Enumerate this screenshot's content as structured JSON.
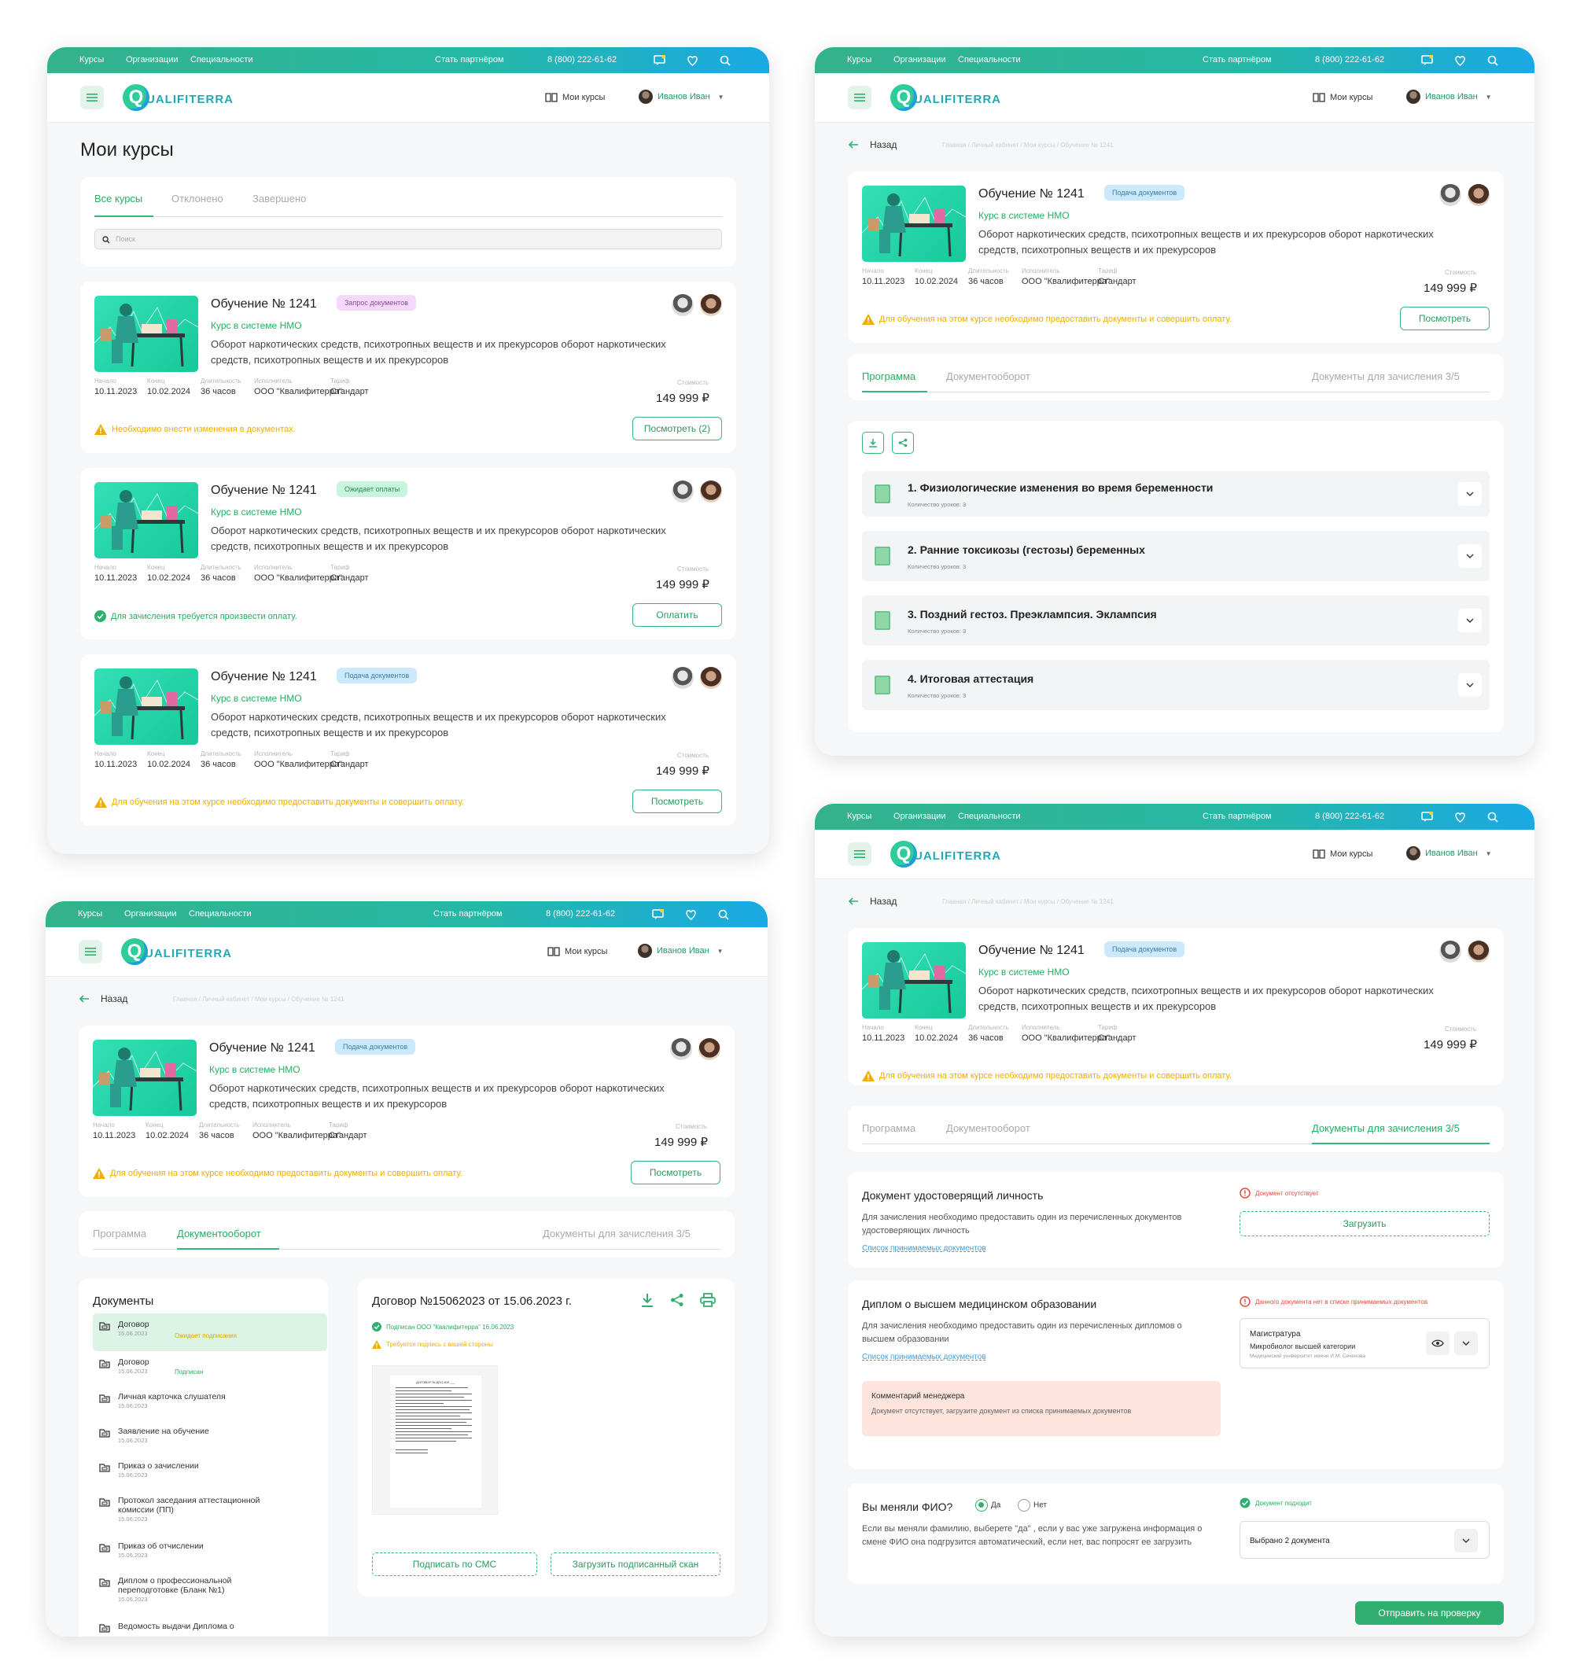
{
  "nav": {
    "courses": "Курсы",
    "organizations": "Организации",
    "specialties": "Специальности",
    "partner": "Стать партнёром",
    "phone": "8 (800) 222-61-62",
    "logo_text": "UALIFITERRA",
    "my_courses": "Мои курсы",
    "user_name": "Иванов Иван"
  },
  "colors": {
    "accent": "#2fb070",
    "gradient_start": "#34b28b",
    "gradient_end": "#1aa9e4",
    "warning": "#f0ad00",
    "error": "#e84a3a"
  },
  "icons": [
    "menu-icon",
    "chat-icon",
    "heart-icon",
    "search-icon",
    "book-icon",
    "chevron-down-icon",
    "warning-icon",
    "check-circle-icon",
    "download-icon",
    "share-icon",
    "print-icon",
    "folder-icon",
    "eye-icon",
    "arrow-left-icon",
    "error-icon"
  ],
  "list_page": {
    "title": "Мои курсы",
    "tabs": [
      "Все курсы",
      "Отклонено",
      "Завершено"
    ],
    "search_placeholder": "Поиск",
    "courses": [
      {
        "title": "Обучение № 1241",
        "badge": "Запрос документов",
        "subtitle": "Курс в системе НМО",
        "description": "Оборот наркотических средств, психотропных веществ  и их прекурсоров оборот наркотических средств, психотропных веществ  и их прекурсоров",
        "start_label": "Начало",
        "start": "10.11.2023",
        "end_label": "Конец",
        "end": "10.02.2024",
        "dur_label": "Длительность",
        "duration": "36 часов",
        "exec_label": "Исполнитель",
        "executor": "ООО \"Квалифитерра\"",
        "tariff_label": "Тариф",
        "tariff": "Стандарт",
        "cost_label": "Стоимость",
        "price": "149 999 ₽",
        "notice": "Необходимо внести изменения в документах.",
        "button": "Посмотреть (2)"
      },
      {
        "title": "Обучение № 1241",
        "badge": "Ожидает оплаты",
        "subtitle": "Курс в системе НМО",
        "description": "Оборот наркотических средств, психотропных веществ  и их прекурсоров оборот наркотических средств, психотропных веществ  и их прекурсоров",
        "start_label": "Начало",
        "start": "10.11.2023",
        "end_label": "Конец",
        "end": "10.02.2024",
        "dur_label": "Длительность",
        "duration": "36 часов",
        "exec_label": "Исполнитель",
        "executor": "ООО \"Квалифитерра\"",
        "tariff_label": "Тариф",
        "tariff": "Стандарт",
        "cost_label": "Стоимость",
        "price": "149 999 ₽",
        "notice": "Для зачисления требуется произвести оплату.",
        "button": "Оплатить"
      },
      {
        "title": "Обучение № 1241",
        "badge": "Подача документов",
        "subtitle": "Курс в системе НМО",
        "description": "Оборот наркотических средств, психотропных веществ  и их прекурсоров оборот наркотических средств, психотропных веществ  и их прекурсоров",
        "start_label": "Начало",
        "start": "10.11.2023",
        "end_label": "Конец",
        "end": "10.02.2024",
        "dur_label": "Длительность",
        "duration": "36 часов",
        "exec_label": "Исполнитель",
        "executor": "ООО \"Квалифитерра\"",
        "tariff_label": "Тариф",
        "tariff": "Стандарт",
        "cost_label": "Стоимость",
        "price": "149 999 ₽",
        "notice": "Для обучения на этом курсе необходимо предоставить документы и совершить оплату.",
        "button": "Посмотреть"
      }
    ]
  },
  "detail": {
    "back": "Назад",
    "breadcrumbs": "Главная / Личный кабинет / Мои курсы / Обучение № 1241",
    "title": "Обучение № 1241",
    "badge": "Подача документов",
    "subtitle": "Курс в системе НМО",
    "description": "Оборот наркотических средств, психотропных веществ  и их прекурсоров оборот наркотических средств, психотропных веществ  и их прекурсоров",
    "start_label": "Начало",
    "start": "10.11.2023",
    "end_label": "Конец",
    "end": "10.02.2024",
    "dur_label": "Длительность",
    "duration": "36 часов",
    "exec_label": "Исполнитель",
    "executor": "ООО \"Квалифитерра\"",
    "tariff_label": "Тариф",
    "tariff": "Стандарт",
    "cost_label": "Стоимость",
    "price": "149 999 ₽",
    "notice": "Для обучения на этом курсе необходимо предоставить документы и совершить оплату.",
    "button": "Посмотреть",
    "tabs": [
      "Программа",
      "Документооборот",
      "Документы для зачисления 3/5"
    ]
  },
  "program": {
    "modules": [
      {
        "title": "1. Физиологические изменения во время беременности",
        "lessons": "Количество уроков: 3"
      },
      {
        "title": "2. Ранние токсикозы (гестозы) беременных",
        "lessons": "Количество уроков: 3"
      },
      {
        "title": "3. Поздний гестоз. Преэклампсия. Эклампсия",
        "lessons": "Количество уроков: 3"
      },
      {
        "title": "4. Итоговая аттестация",
        "lessons": "Количество уроков: 3"
      }
    ]
  },
  "docflow": {
    "list_title": "Документы",
    "documents": [
      {
        "name": "Договор",
        "date": "15.06.2023",
        "status": "Ожидает подписания"
      },
      {
        "name": "Договор",
        "date": "15.06.2023",
        "status": "Подписан"
      },
      {
        "name": "Личная карточка слушателя",
        "date": "15.06.2023",
        "status": ""
      },
      {
        "name": "Заявление на обучение",
        "date": "15.06.2023",
        "status": ""
      },
      {
        "name": "Приказ о зачислении",
        "date": "15.06.2023",
        "status": ""
      },
      {
        "name": "Протокол заседания аттестационной комиссии (ПП)",
        "date": "15.06.2023",
        "status": ""
      },
      {
        "name": "Приказ об отчислении",
        "date": "15.06.2023",
        "status": ""
      },
      {
        "name": "Диплом о профессиональной переподготовке (Бланк №1)",
        "date": "15.06.2023",
        "status": ""
      },
      {
        "name": "Ведомость выдачи Диплома о",
        "date": "",
        "status": ""
      }
    ],
    "contract_title": "Договор №15062023 от 15.06.2023 г.",
    "signed_by": "Подписан ООО \"Квалифитерра\" 16.06.2023",
    "need_sign": "Требуется подпись с вашей стороны",
    "preview_title": "ДОГОВОР № ДПО-ЮЛ ___",
    "sign_sms": "Подписать по СМС",
    "upload_scan": "Загрузить подписанный скан"
  },
  "enrollment": {
    "sections": [
      {
        "title": "Документ удостоверящий личность",
        "text": "Для зачисления необходимо предоставить один из перечисленных документов удостоверяющих личность",
        "link": "Список принимаемых документов",
        "status": "Документ отсутствует",
        "action": "Загрузить"
      },
      {
        "title": "Диплом о высшем медицинском образовании",
        "text": "Для зачисления необходимо предоставить один из перечисленных дипломов о высшем образовании",
        "link": "Список принимаемых документов",
        "status": "Данного документа нет в списке принимаемых документов",
        "doc_type": "Магистратура",
        "doc_name": "Микробиолог высшей категории",
        "doc_org": "Медицинский университет имени И.М. Сеченова",
        "comment_title": "Комментарий менеджера",
        "comment": "Документ отсутствует, загрузите документ из списка принимаемых документов"
      }
    ],
    "fio_question": "Вы меняли ФИО?",
    "yes": "Да",
    "no": "Нет",
    "fio_text": "Если вы меняли фамилию, выберете \"да\" , если у вас уже загружена информация о смене ФИО она подгрузится автоматический, если нет, вас попросят ее загрузить",
    "fio_status": "Документ подходит",
    "fio_select": "Выбрано 2 документа",
    "submit": "Отправить на проверку"
  }
}
